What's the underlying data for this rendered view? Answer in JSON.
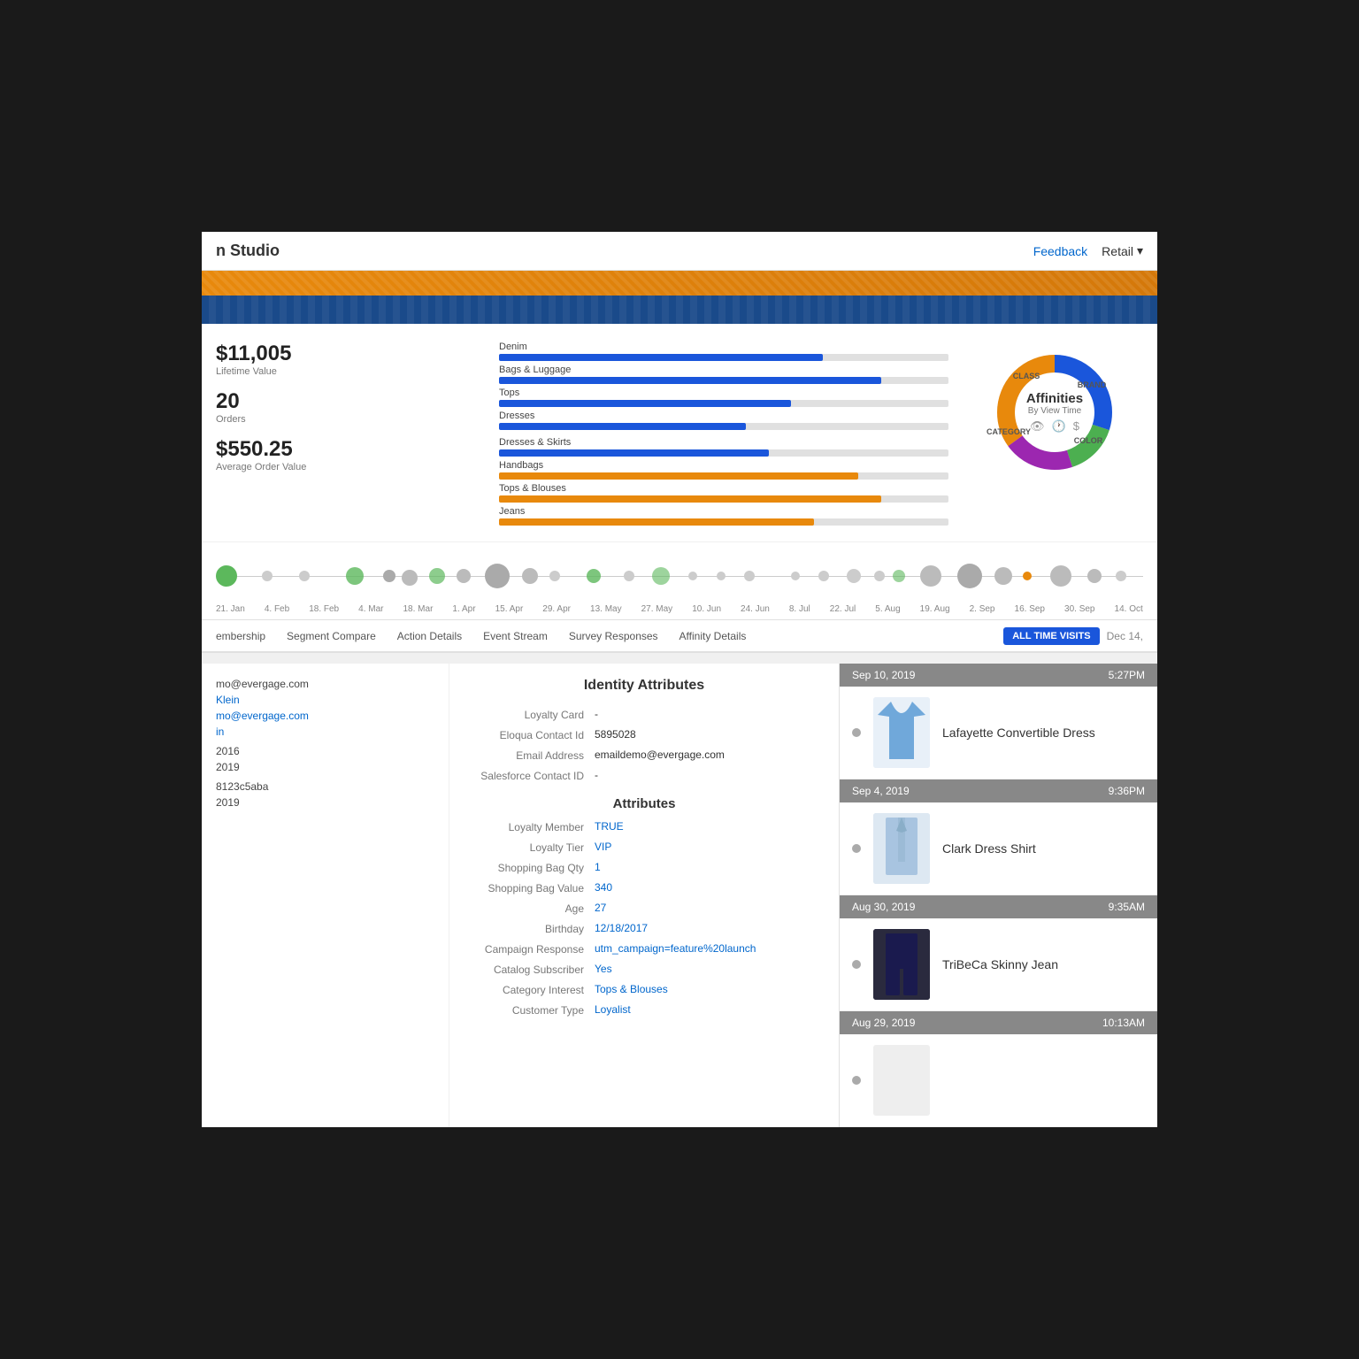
{
  "header": {
    "title": "n Studio",
    "feedback_label": "Feedback",
    "retail_label": "Retail"
  },
  "stats": {
    "lifetime_value": "$11,005",
    "lifetime_value_label": "Lifetime Value",
    "orders": "20",
    "orders_label": "Orders",
    "avg_order": "$550.25",
    "avg_order_label": "Average Order Value"
  },
  "affinities": {
    "title": "Affinities",
    "subtitle": "By View Time",
    "top_bars": [
      {
        "label": "Denim",
        "pct": 72,
        "type": "blue"
      },
      {
        "label": "Bags & Luggage",
        "pct": 85,
        "type": "blue"
      },
      {
        "label": "Tops",
        "pct": 65,
        "type": "blue"
      },
      {
        "label": "Dresses",
        "pct": 55,
        "type": "blue"
      }
    ],
    "bottom_bars": [
      {
        "label": "Dresses & Skirts",
        "pct": 60,
        "type": "blue"
      },
      {
        "label": "Handbags",
        "pct": 80,
        "type": "orange"
      },
      {
        "label": "Tops & Blouses",
        "pct": 85,
        "type": "orange"
      },
      {
        "label": "Jeans",
        "pct": 70,
        "type": "orange"
      }
    ],
    "donut_segments": [
      {
        "label": "CLASS",
        "color": "#1a56db",
        "pct": 30
      },
      {
        "label": "BRAND",
        "color": "#4caf50",
        "pct": 15
      },
      {
        "label": "COLOR",
        "color": "#9c27b0",
        "pct": 20
      },
      {
        "label": "CATEGORY",
        "color": "#e8890c",
        "pct": 35
      }
    ]
  },
  "timeline": {
    "labels": [
      "21. Jan",
      "4. Feb",
      "18. Feb",
      "4. Mar",
      "18. Mar",
      "1. Apr",
      "15. Apr",
      "29. Apr",
      "13. May",
      "27. May",
      "10. Jun",
      "24. Jun",
      "8. Jul",
      "22. Jul",
      "5. Aug",
      "19. Aug",
      "2. Sep",
      "16. Sep",
      "30. Sep",
      "14. Oct"
    ]
  },
  "nav_tabs": {
    "items": [
      "embership",
      "Segment Compare",
      "Action Details",
      "Event Stream",
      "Survey Responses",
      "Affinity Details"
    ],
    "all_time_label": "ALL TIME VISITS",
    "date_label": "Dec 14,"
  },
  "left_panel": {
    "email1": "mo@evergage.com",
    "link1": "Klein",
    "email2": "mo@evergage.com",
    "link2": "in",
    "date1": "2016",
    "date2": "2019",
    "id": "8123c5aba",
    "date3": "2019"
  },
  "identity_attributes": {
    "title": "Identity Attributes",
    "fields": [
      {
        "label": "Loyalty Card",
        "value": "-",
        "is_link": false
      },
      {
        "label": "Eloqua Contact Id",
        "value": "5895028",
        "is_link": false
      },
      {
        "label": "Email Address",
        "value": "emaildemo@evergage.com",
        "is_link": false
      },
      {
        "label": "Salesforce Contact ID",
        "value": "-",
        "is_link": false
      }
    ]
  },
  "attributes": {
    "title": "Attributes",
    "fields": [
      {
        "label": "Loyalty Member",
        "value": "TRUE",
        "is_link": true
      },
      {
        "label": "Loyalty Tier",
        "value": "VIP",
        "is_link": true
      },
      {
        "label": "Shopping Bag Qty",
        "value": "1",
        "is_link": true
      },
      {
        "label": "Shopping Bag Value",
        "value": "340",
        "is_link": true
      },
      {
        "label": "Age",
        "value": "27",
        "is_link": true
      },
      {
        "label": "Birthday",
        "value": "12/18/2017",
        "is_link": true
      },
      {
        "label": "Campaign Response",
        "value": "utm_campaign=feature%20launch",
        "is_link": true
      },
      {
        "label": "Catalog Subscriber",
        "value": "Yes",
        "is_link": true
      },
      {
        "label": "Category Interest",
        "value": "Tops & Blouses",
        "is_link": true
      },
      {
        "label": "Customer Type",
        "value": "Loyalist",
        "is_link": true
      }
    ]
  },
  "product_stream": {
    "entries": [
      {
        "date": "Sep 10, 2019",
        "time": "5:27PM",
        "product_name": "Lafayette Convertible Dress",
        "product_emoji": "👗",
        "product_color": "#5b9bd5"
      },
      {
        "date": "Sep 4, 2019",
        "time": "9:36PM",
        "product_name": "Clark Dress Shirt",
        "product_emoji": "👔",
        "product_color": "#a8c4e0"
      },
      {
        "date": "Aug 30, 2019",
        "time": "9:35AM",
        "product_name": "TriBeCa Skinny Jean",
        "product_emoji": "👖",
        "product_color": "#1a1a2e"
      },
      {
        "date": "Aug 29, 2019",
        "time": "10:13AM",
        "product_name": "",
        "product_emoji": "",
        "product_color": "#ccc"
      }
    ]
  }
}
